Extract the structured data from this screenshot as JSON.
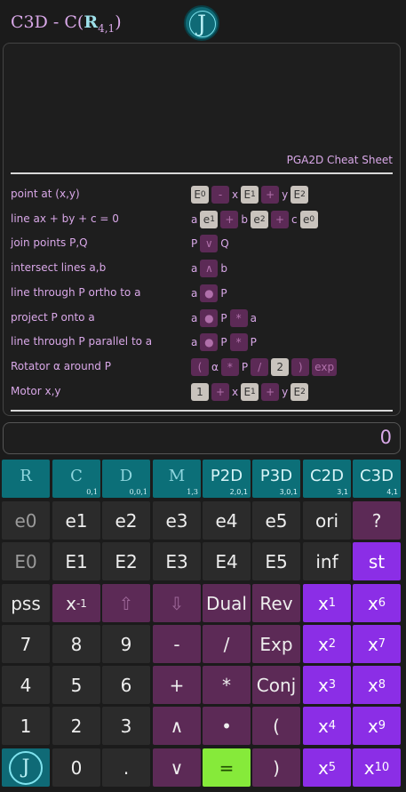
{
  "header": {
    "title_prefix": "C3D - C(",
    "title_r": "R",
    "title_sub": "4,1",
    "title_suffix": ")",
    "logo_letter": "J"
  },
  "cheat_sheet": {
    "title": "PGA2D Cheat Sheet",
    "rows": [
      {
        "label": "point at (x,y)"
      },
      {
        "label": "line ax + by + c = 0"
      },
      {
        "label": "join points P,Q"
      },
      {
        "label": "intersect lines a,b"
      },
      {
        "label": "line through P ortho to a"
      },
      {
        "label": "project P onto a"
      },
      {
        "label": "line through P parallel to a"
      },
      {
        "label": "Rotator α around P"
      },
      {
        "label": "Motor x,y"
      }
    ]
  },
  "display": {
    "value": "0"
  },
  "keypad": {
    "algebras": [
      {
        "label": "R",
        "sig": ""
      },
      {
        "label": "C",
        "sig": "0,1"
      },
      {
        "label": "D",
        "sig": "0,0,1"
      },
      {
        "label": "M",
        "sig": "1,3"
      },
      {
        "label": "P2D",
        "sig": "2,0,1"
      },
      {
        "label": "P3D",
        "sig": "3,0,1"
      },
      {
        "label": "C2D",
        "sig": "3,1"
      },
      {
        "label": "C3D",
        "sig": "4,1"
      }
    ],
    "row2": [
      "e0",
      "e1",
      "e2",
      "e3",
      "e4",
      "e5",
      "ori",
      "?"
    ],
    "row3": [
      "E0",
      "E1",
      "E2",
      "E3",
      "E4",
      "E5",
      "inf",
      "st"
    ],
    "row4": [
      "pss",
      "x-1",
      "⇧",
      "⇩",
      "Dual",
      "Rev",
      "x1",
      "x6"
    ],
    "row5": [
      "7",
      "8",
      "9",
      "-",
      "/",
      "Exp",
      "x2",
      "x7"
    ],
    "row6": [
      "4",
      "5",
      "6",
      "+",
      "*",
      "Conj",
      "x3",
      "x8"
    ],
    "row7": [
      "1",
      "2",
      "3",
      "∧",
      "•",
      "(",
      "x4",
      "x9"
    ],
    "row8": [
      "J",
      "0",
      ".",
      "∨",
      "=",
      ")",
      "x5",
      "x10"
    ]
  },
  "colors": {
    "teal": "#0c6f78",
    "purple": "#5c2a56",
    "violet": "#8b2ee6",
    "green": "#86ea3a"
  }
}
